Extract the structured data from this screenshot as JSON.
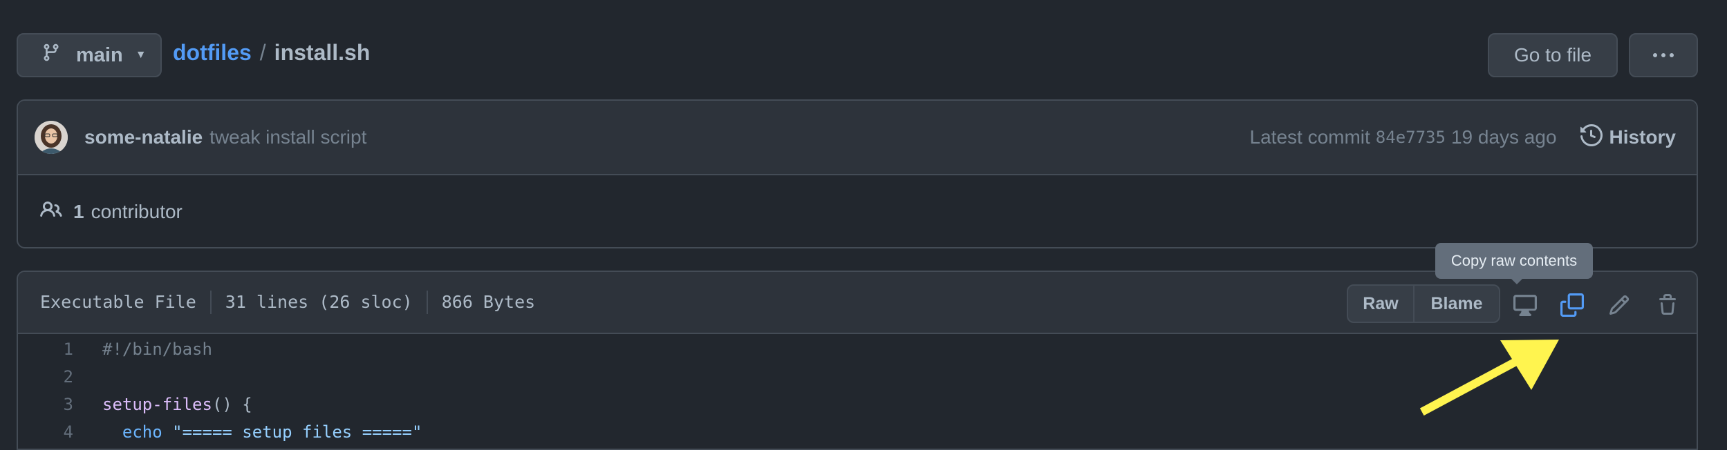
{
  "header": {
    "branch": "main",
    "repo": "dotfiles",
    "separator": "/",
    "filename": "install.sh",
    "go_to_file": "Go to file"
  },
  "commit": {
    "author": "some-natalie",
    "message": "tweak install script",
    "latest_label": "Latest commit",
    "sha": "84e7735",
    "age": "19 days ago",
    "history_label": "History"
  },
  "contributors": {
    "count": "1",
    "label": "contributor"
  },
  "file": {
    "type": "Executable File",
    "lines": "31 lines (26 sloc)",
    "size": "866 Bytes",
    "raw_label": "Raw",
    "blame_label": "Blame"
  },
  "tooltip": "Copy raw contents",
  "code": [
    {
      "n": "1",
      "text": "#!/bin/bash"
    },
    {
      "n": "2",
      "text": ""
    },
    {
      "n": "3",
      "func": "setup-files",
      "rest": "() {"
    },
    {
      "n": "4",
      "kw": "echo",
      "str": "\"===== setup files =====\""
    }
  ],
  "colors": {
    "background": "#22272e",
    "link": "#539bf5",
    "accent_icon": "#539bf5",
    "arrow": "#fff44f"
  }
}
